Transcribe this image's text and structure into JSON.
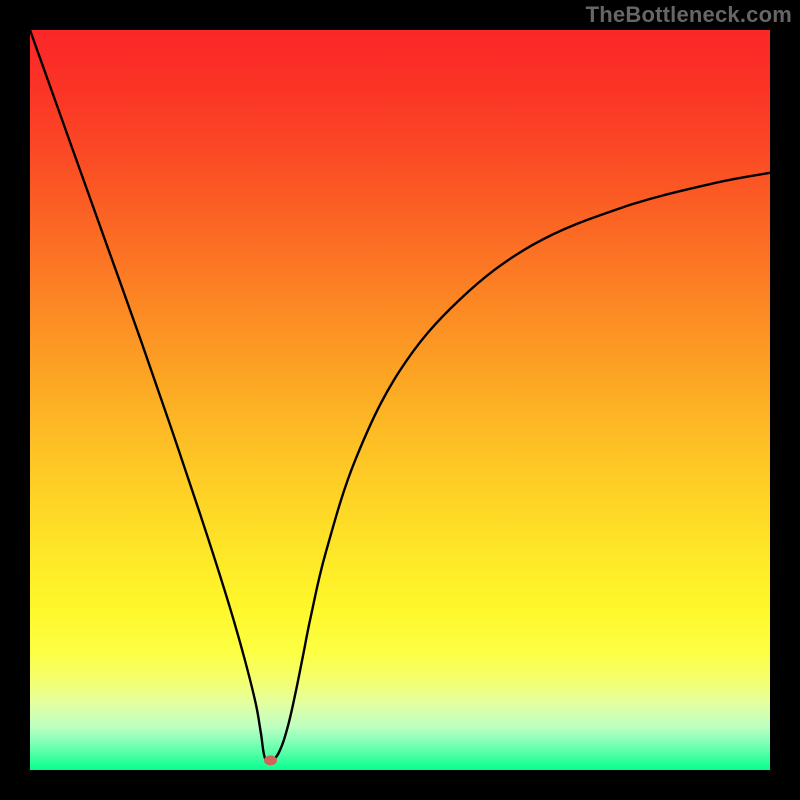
{
  "brand": "TheBottleneck.com",
  "chart_data": {
    "type": "line",
    "title": "",
    "xlabel": "",
    "ylabel": "",
    "xlim": [
      0,
      100
    ],
    "ylim": [
      0,
      100
    ],
    "gradient_stops": [
      {
        "offset": 0.0,
        "color": "#fb2728"
      },
      {
        "offset": 0.07,
        "color": "#fb3226"
      },
      {
        "offset": 0.15,
        "color": "#fb4525"
      },
      {
        "offset": 0.25,
        "color": "#fb6224"
      },
      {
        "offset": 0.35,
        "color": "#fc8124"
      },
      {
        "offset": 0.45,
        "color": "#fc9f24"
      },
      {
        "offset": 0.55,
        "color": "#fdbd25"
      },
      {
        "offset": 0.65,
        "color": "#fed826"
      },
      {
        "offset": 0.72,
        "color": "#feea28"
      },
      {
        "offset": 0.78,
        "color": "#fef72b"
      },
      {
        "offset": 0.84,
        "color": "#fdff43"
      },
      {
        "offset": 0.88,
        "color": "#f4ff70"
      },
      {
        "offset": 0.91,
        "color": "#e3ffa0"
      },
      {
        "offset": 0.94,
        "color": "#c0ffc1"
      },
      {
        "offset": 0.96,
        "color": "#89ffb9"
      },
      {
        "offset": 0.98,
        "color": "#4affa4"
      },
      {
        "offset": 1.0,
        "color": "#04ff8f"
      }
    ],
    "series": [
      {
        "name": "curve",
        "x": [
          0,
          5,
          10,
          15,
          20,
          24,
          27,
          29,
          30.5,
          31.2,
          31.8,
          33,
          34,
          35,
          36,
          37,
          38,
          40,
          44,
          50,
          58,
          68,
          80,
          92,
          100
        ],
        "y": [
          100,
          86,
          72,
          58,
          43.5,
          31.5,
          22,
          15,
          9,
          5,
          1.5,
          1.5,
          3.2,
          6.5,
          11,
          16,
          21,
          29.5,
          42,
          54,
          63.5,
          71,
          76,
          79.2,
          80.7
        ]
      }
    ],
    "marker": {
      "x": 32.5,
      "y": 1.3,
      "color": "#d1635b"
    }
  }
}
